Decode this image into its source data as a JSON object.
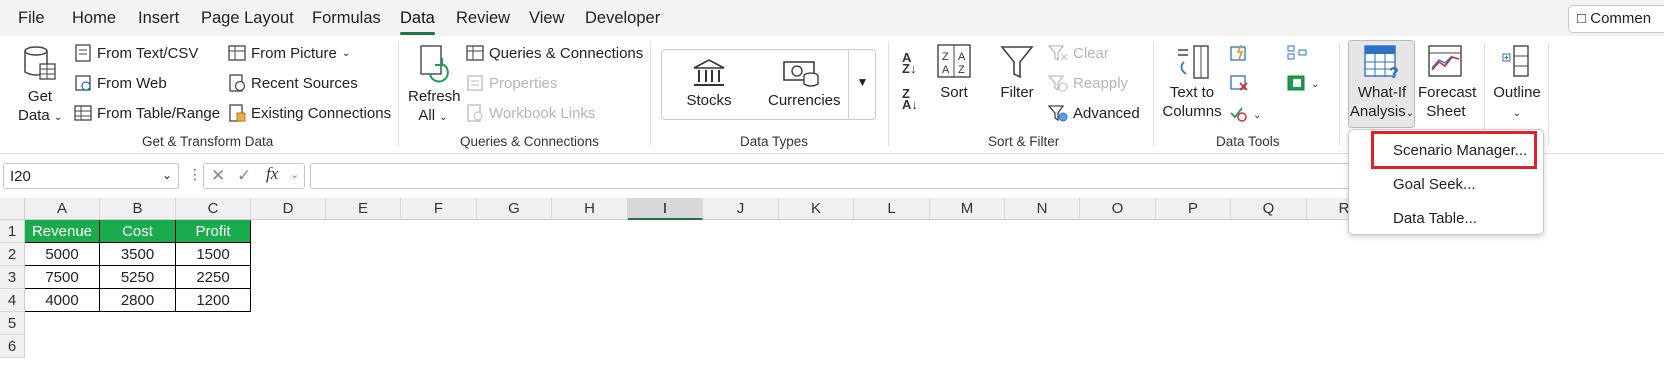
{
  "menu": {
    "tabs": [
      "File",
      "Home",
      "Insert",
      "Page Layout",
      "Formulas",
      "Data",
      "Review",
      "View",
      "Developer"
    ],
    "active_tab": "Data",
    "comments_label": "Commen"
  },
  "ribbon": {
    "get_transform": {
      "get_data": "Get",
      "get_data_line2": "Data",
      "from_text_csv": "From Text/CSV",
      "from_web": "From Web",
      "from_table_range": "From Table/Range",
      "from_picture": "From Picture",
      "recent_sources": "Recent Sources",
      "existing_connections": "Existing Connections",
      "label": "Get & Transform Data"
    },
    "queries": {
      "refresh_all": "Refresh",
      "refresh_all_line2": "All",
      "queries_connections": "Queries & Connections",
      "properties": "Properties",
      "workbook_links": "Workbook Links",
      "label": "Queries & Connections"
    },
    "data_types": {
      "stocks": "Stocks",
      "currencies": "Currencies",
      "label": "Data Types"
    },
    "sort_filter": {
      "sort": "Sort",
      "filter": "Filter",
      "clear": "Clear",
      "reapply": "Reapply",
      "advanced": "Advanced",
      "label": "Sort & Filter"
    },
    "data_tools": {
      "text_to_columns": "Text to",
      "text_to_columns_line2": "Columns",
      "label": "Data Tools"
    },
    "forecast": {
      "what_if": "What-If",
      "what_if_line2": "Analysis",
      "forecast_sheet": "Forecast",
      "forecast_sheet_line2": "Sheet"
    },
    "outline": {
      "label": "Outline"
    }
  },
  "formula_bar": {
    "name_box": "I20",
    "fx": "fx",
    "formula": ""
  },
  "grid": {
    "columns": [
      "A",
      "B",
      "C",
      "D",
      "E",
      "F",
      "G",
      "H",
      "I",
      "J",
      "K",
      "L",
      "M",
      "N",
      "O",
      "P",
      "Q",
      "R"
    ],
    "selected_column": "I",
    "rows": [
      "1",
      "2",
      "3",
      "4",
      "5",
      "6"
    ],
    "table": {
      "headers": [
        "Revenue",
        "Cost",
        "Profit"
      ],
      "data": [
        [
          "5000",
          "3500",
          "1500"
        ],
        [
          "7500",
          "5250",
          "2250"
        ],
        [
          "4000",
          "2800",
          "1200"
        ]
      ]
    }
  },
  "what_if_menu": {
    "items": [
      "Scenario Manager...",
      "Goal Seek...",
      "Data Table..."
    ],
    "highlighted": "Scenario Manager..."
  },
  "colors": {
    "accent": "#217346",
    "table_header": "#1aac4c",
    "highlight_box": "#e0202a"
  }
}
